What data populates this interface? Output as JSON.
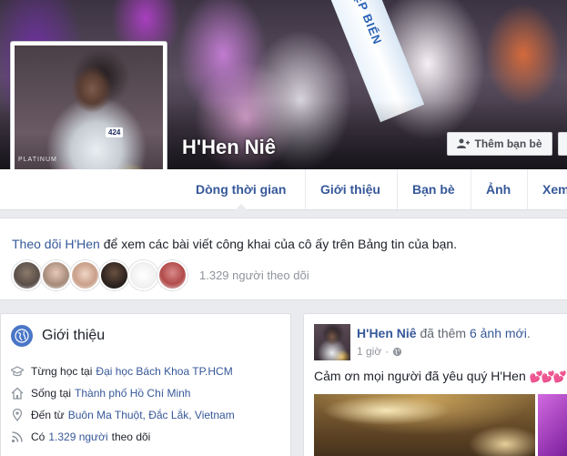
{
  "cover": {
    "sash_text": "ỚI ĐẸP BIỂN"
  },
  "profile": {
    "name": "H'Hen Niê",
    "picture_badge": "424",
    "picture_banner": "PLATINUM",
    "add_friend_label": "Thêm bạn bè"
  },
  "tabs": [
    {
      "label": "Dòng thời gian"
    },
    {
      "label": "Giới thiệu"
    },
    {
      "label": "Bạn bè"
    },
    {
      "label": "Ảnh"
    },
    {
      "label": "Xem"
    }
  ],
  "follow_box": {
    "link": "Theo dõi H'Hen",
    "rest": " để xem các bài viết công khai của cô ấy trên Bảng tin của bạn.",
    "followers_count": "1.329 người theo dõi"
  },
  "intro": {
    "title": "Giới thiệu",
    "studied_prefix": "Từng học tại",
    "studied_at": "Đại học Bách Khoa TP.HCM",
    "lives_prefix": "Sống tại",
    "lives_in": "Thành phố Hồ Chí Minh",
    "from_prefix": "Đến từ",
    "from_place": "Buôn Ma Thuột, Đắc Lắk, Vietnam",
    "has_prefix": "Có",
    "followers_link": "1.329 người",
    "followers_suffix": "theo dõi"
  },
  "post": {
    "author": "H'Hen Niê",
    "action": " đã thêm ",
    "photos": "6 ảnh mới",
    "dot": ".",
    "time": "1 giờ",
    "separator": "·",
    "text": "Cảm ơn mọi người đã yêu quý H'Hen",
    "hearts": "💕💕💕"
  },
  "colors": {
    "link": "#365899",
    "page_bg": "#e9ebee",
    "card_bg": "#ffffff",
    "muted": "#90949c",
    "globe": "#4a76c7"
  }
}
